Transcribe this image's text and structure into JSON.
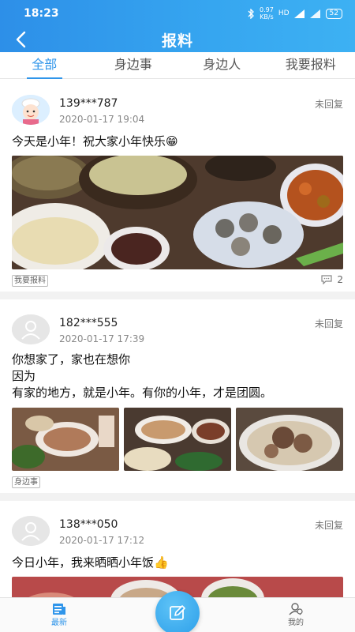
{
  "status_bar": {
    "time": "18:23",
    "speed_value": "0.97",
    "speed_unit": "KB/s",
    "hd": "HD",
    "battery": "52"
  },
  "header": {
    "title": "报料"
  },
  "tabs": [
    {
      "label": "全部",
      "active": true
    },
    {
      "label": "身边事",
      "active": false
    },
    {
      "label": "身边人",
      "active": false
    },
    {
      "label": "我要报料",
      "active": false
    }
  ],
  "posts": [
    {
      "username": "139***787",
      "time": "2020-01-17 19:04",
      "reply_status": "未回复",
      "content": "今天是小年！祝大家小年快乐😁",
      "tag": "我要报料",
      "comment_count": "2"
    },
    {
      "username": "182***555",
      "time": "2020-01-17 17:39",
      "reply_status": "未回复",
      "content_lines": [
        "你想家了，家也在想你",
        "因为",
        "有家的地方，就是小年。有你的小年，才是团圆。"
      ],
      "tag": "身边事"
    },
    {
      "username": "138***050",
      "time": "2020-01-17 17:12",
      "reply_status": "未回复",
      "content": "今日小年，我来晒晒小年饭👍"
    }
  ],
  "bottom_nav": {
    "latest": "最新",
    "mine": "我的"
  },
  "colors": {
    "accent": "#2f95ea",
    "header_start": "#2d8fe8",
    "header_end": "#3db1f3"
  }
}
